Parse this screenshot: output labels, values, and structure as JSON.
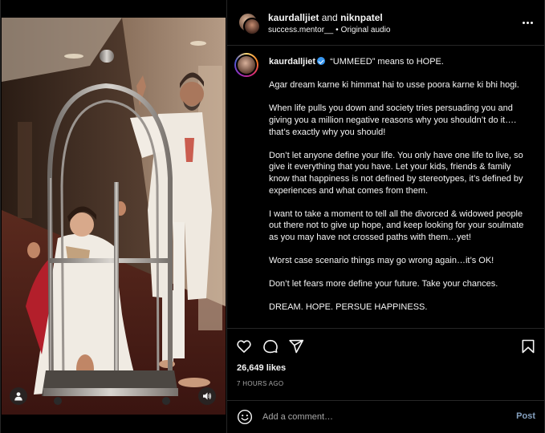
{
  "header": {
    "user1": "kaurdalljiet",
    "joiner": "and",
    "user2": "niknpatel",
    "audio_user": "success.mentor__",
    "separator": "•",
    "audio_label": "Original audio"
  },
  "caption": {
    "username": "kaurdalljiet",
    "paragraphs": [
      "“UMMEED” means to HOPE.",
      "Agar dream karne ki himmat hai to usse poora karne ki bhi hogi.",
      "When life pulls you down and society tries persuading you and giving you a million negative reasons why you shouldn’t do it…. that’s exactly why you should!",
      "Don’t let anyone define your life. You only have one life to live, so give it everything that you have. Let your kids, friends & family know that happiness is not defined by stereotypes, it’s defined by experiences and what comes from them.",
      "I want to take a moment to tell all the divorced & widowed people out there not to give up hope, and keep looking for your soulmate as you may have not crossed paths with them…yet!",
      "Worst case scenario things may go wrong again…it’s OK!",
      "Don’t let fears more define your future. Take your chances.",
      "DREAM. HOPE. PERSUE HAPPINESS."
    ]
  },
  "stats": {
    "likes": "26,649 likes",
    "time_ago": "7 HOURS AGO"
  },
  "comment": {
    "placeholder": "Add a comment…",
    "post_label": "Post"
  },
  "colors": {
    "background": "#000000",
    "text": "#f5f5f5",
    "muted": "#a8a8a8",
    "divider": "#262626",
    "verified": "#3897f0",
    "post_button": "#85a1bf"
  },
  "icons": [
    "more-icon",
    "verified-icon",
    "heart-icon",
    "comment-icon",
    "share-icon",
    "bookmark-icon",
    "emoji-icon",
    "tag-people-icon",
    "speaker-icon"
  ]
}
